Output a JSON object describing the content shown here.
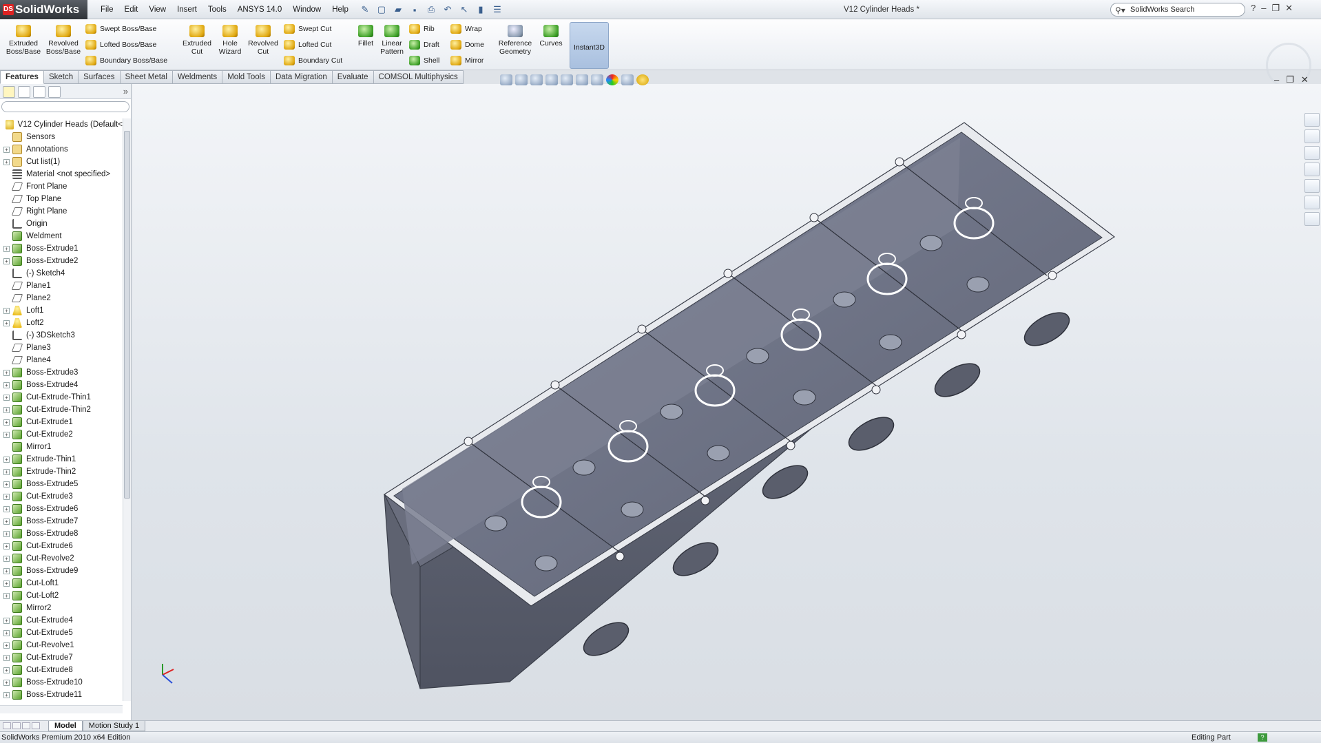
{
  "app": {
    "name": "SolidWorks",
    "logo_mark": "DS",
    "edition": "SolidWorks Premium 2010 x64 Edition"
  },
  "menu": [
    "File",
    "Edit",
    "View",
    "Insert",
    "Tools",
    "ANSYS 14.0",
    "Window",
    "Help"
  ],
  "document": {
    "title": "V12 Cylinder Heads *"
  },
  "search": {
    "placeholder": "SolidWorks Search"
  },
  "ribbon": {
    "extruded_boss": "Extruded Boss/Base",
    "revolved_boss": "Revolved Boss/Base",
    "swept_boss": "Swept Boss/Base",
    "lofted_boss": "Lofted Boss/Base",
    "boundary_boss": "Boundary Boss/Base",
    "extruded_cut": "Extruded Cut",
    "hole_wizard": "Hole Wizard",
    "revolved_cut": "Revolved Cut",
    "swept_cut": "Swept Cut",
    "lofted_cut": "Lofted Cut",
    "boundary_cut": "Boundary Cut",
    "fillet": "Fillet",
    "linear_pattern": "Linear Pattern",
    "rib": "Rib",
    "draft": "Draft",
    "shell": "Shell",
    "wrap": "Wrap",
    "dome": "Dome",
    "mirror": "Mirror",
    "reference_geometry": "Reference Geometry",
    "curves": "Curves",
    "instant3d": "Instant3D"
  },
  "tabs": [
    {
      "label": "Features",
      "active": true
    },
    {
      "label": "Sketch"
    },
    {
      "label": "Surfaces"
    },
    {
      "label": "Sheet Metal"
    },
    {
      "label": "Weldments"
    },
    {
      "label": "Mold Tools"
    },
    {
      "label": "Data Migration"
    },
    {
      "label": "Evaluate"
    },
    {
      "label": "COMSOL Multiphysics"
    }
  ],
  "tree": {
    "root": "V12 Cylinder Heads  (Default<",
    "items": [
      {
        "label": "Sensors",
        "icon": "sensor-icon",
        "expandable": false
      },
      {
        "label": "Annotations",
        "icon": "annotations-icon",
        "expandable": true
      },
      {
        "label": "Cut list(1)",
        "icon": "cut-list-icon",
        "expandable": true
      },
      {
        "label": "Material <not specified>",
        "icon": "material-icon",
        "expandable": false
      },
      {
        "label": "Front Plane",
        "icon": "plane-icon",
        "expandable": false
      },
      {
        "label": "Top Plane",
        "icon": "plane-icon",
        "expandable": false
      },
      {
        "label": "Right Plane",
        "icon": "plane-icon",
        "expandable": false
      },
      {
        "label": "Origin",
        "icon": "origin-icon",
        "expandable": false
      },
      {
        "label": "Weldment",
        "icon": "weldment-icon",
        "expandable": false
      },
      {
        "label": "Boss-Extrude1",
        "icon": "feature-icon",
        "expandable": true
      },
      {
        "label": "Boss-Extrude2",
        "icon": "feature-icon",
        "expandable": true
      },
      {
        "label": "(-) Sketch4",
        "icon": "sketch-icon",
        "expandable": false
      },
      {
        "label": "Plane1",
        "icon": "plane-icon",
        "expandable": false
      },
      {
        "label": "Plane2",
        "icon": "plane-icon",
        "expandable": false
      },
      {
        "label": "Loft1",
        "icon": "loft-icon",
        "expandable": true
      },
      {
        "label": "Loft2",
        "icon": "loft-icon",
        "expandable": true
      },
      {
        "label": "(-) 3DSketch3",
        "icon": "sketch-icon",
        "expandable": false
      },
      {
        "label": "Plane3",
        "icon": "plane-icon",
        "expandable": false
      },
      {
        "label": "Plane4",
        "icon": "plane-icon",
        "expandable": false
      },
      {
        "label": "Boss-Extrude3",
        "icon": "feature-icon",
        "expandable": true
      },
      {
        "label": "Boss-Extrude4",
        "icon": "feature-icon",
        "expandable": true
      },
      {
        "label": "Cut-Extrude-Thin1",
        "icon": "feature-icon",
        "expandable": true
      },
      {
        "label": "Cut-Extrude-Thin2",
        "icon": "feature-icon",
        "expandable": true
      },
      {
        "label": "Cut-Extrude1",
        "icon": "feature-icon",
        "expandable": true
      },
      {
        "label": "Cut-Extrude2",
        "icon": "feature-icon",
        "expandable": true
      },
      {
        "label": "Mirror1",
        "icon": "mirror-feature-icon",
        "expandable": false
      },
      {
        "label": "Extrude-Thin1",
        "icon": "feature-icon",
        "expandable": true
      },
      {
        "label": "Extrude-Thin2",
        "icon": "feature-icon",
        "expandable": true
      },
      {
        "label": "Boss-Extrude5",
        "icon": "feature-icon",
        "expandable": true
      },
      {
        "label": "Cut-Extrude3",
        "icon": "feature-icon",
        "expandable": true
      },
      {
        "label": "Boss-Extrude6",
        "icon": "feature-icon",
        "expandable": true
      },
      {
        "label": "Boss-Extrude7",
        "icon": "feature-icon",
        "expandable": true
      },
      {
        "label": "Boss-Extrude8",
        "icon": "feature-icon",
        "expandable": true
      },
      {
        "label": "Cut-Extrude6",
        "icon": "feature-icon",
        "expandable": true
      },
      {
        "label": "Cut-Revolve2",
        "icon": "feature-icon",
        "expandable": true
      },
      {
        "label": "Boss-Extrude9",
        "icon": "feature-icon",
        "expandable": true
      },
      {
        "label": "Cut-Loft1",
        "icon": "feature-icon",
        "expandable": true
      },
      {
        "label": "Cut-Loft2",
        "icon": "feature-icon",
        "expandable": true
      },
      {
        "label": "Mirror2",
        "icon": "mirror-feature-icon",
        "expandable": false
      },
      {
        "label": "Cut-Extrude4",
        "icon": "feature-icon",
        "expandable": true
      },
      {
        "label": "Cut-Extrude5",
        "icon": "feature-icon",
        "expandable": true
      },
      {
        "label": "Cut-Revolve1",
        "icon": "feature-icon",
        "expandable": true
      },
      {
        "label": "Cut-Extrude7",
        "icon": "feature-icon",
        "expandable": true
      },
      {
        "label": "Cut-Extrude8",
        "icon": "feature-icon",
        "expandable": true
      },
      {
        "label": "Boss-Extrude10",
        "icon": "feature-icon",
        "expandable": true
      },
      {
        "label": "Boss-Extrude11",
        "icon": "feature-icon",
        "expandable": true
      }
    ]
  },
  "bottom_tabs": [
    {
      "label": "Model",
      "active": true
    },
    {
      "label": "Motion Study 1"
    }
  ],
  "status": {
    "right": "Editing Part",
    "help": "?"
  },
  "colors": {
    "model": "#6f7484",
    "model_edge": "#3b3f4a",
    "background_top": "#f3f5f8",
    "background_bottom": "#d9dee4"
  }
}
